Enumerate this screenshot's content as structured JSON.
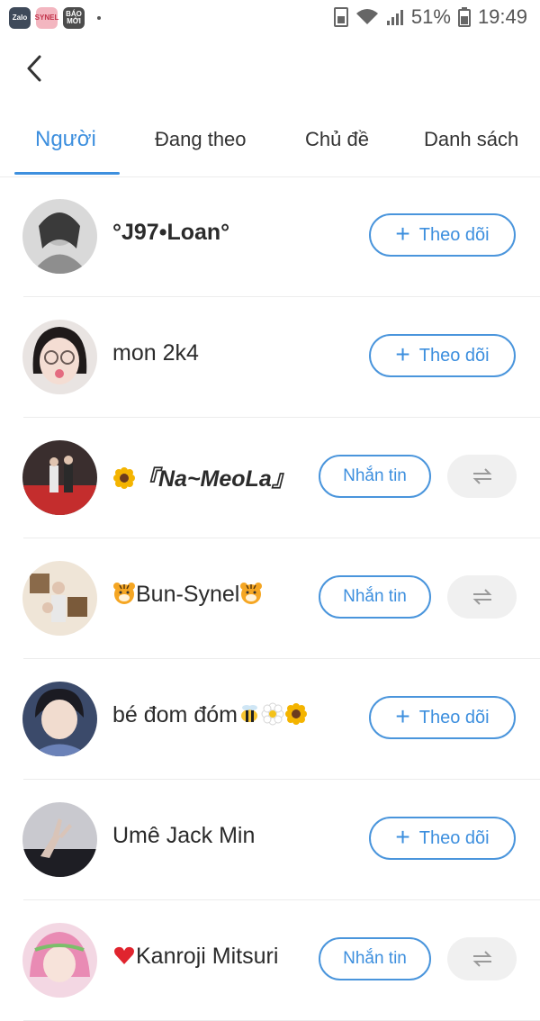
{
  "status_bar": {
    "apps": [
      "Zalo",
      "SYNEL",
      "BÁO MỚI"
    ],
    "battery_percent": "51%",
    "time": "19:49"
  },
  "tabs": [
    {
      "label": "Người",
      "active": true
    },
    {
      "label": "Đang theo",
      "active": false
    },
    {
      "label": "Chủ đề",
      "active": false
    },
    {
      "label": "Danh sách",
      "active": false
    }
  ],
  "buttons": {
    "follow": "Theo dõi",
    "follow_plus": "+",
    "message": "Nhắn tin"
  },
  "users": [
    {
      "name": "°J97•Loan°",
      "action": "follow"
    },
    {
      "name": "mon 2k4",
      "action": "follow"
    },
    {
      "name_prefix_icon": "sunflower",
      "name": "『Na~MeoLa』",
      "action": "message"
    },
    {
      "name_prefix_icon": "tiger-face",
      "name": "Bun-Synel",
      "name_suffix_icon": "tiger-face",
      "action": "message"
    },
    {
      "name": "bé đom đóm",
      "name_suffix_icons": [
        "bee",
        "daisy",
        "sunflower"
      ],
      "action": "follow"
    },
    {
      "name": "Umê Jack Min",
      "action": "follow"
    },
    {
      "name_prefix_icon": "red-heart",
      "name": "Kanroji Mitsuri",
      "action": "message"
    }
  ],
  "colors": {
    "accent": "#3d8fde",
    "divider": "#ececec",
    "mutual_bg": "#f0f0f0"
  }
}
